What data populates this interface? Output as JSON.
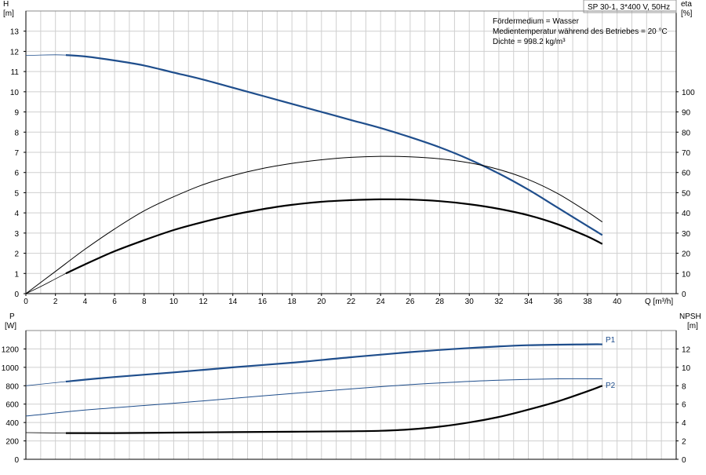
{
  "chart_data": [
    {
      "type": "line",
      "title_box": "SP 30-1, 3*400 V, 50Hz",
      "annotations": [
        "Fördermedium = Wasser",
        "Medientemperatur während des Betriebes = 20 °C",
        "Dichte = 998.2 kg/m³"
      ],
      "ylabel_left": [
        "H",
        "[m]"
      ],
      "ylabel_right": [
        "eta",
        "[%]"
      ],
      "xlabel": "Q [m³/h]",
      "xlim": [
        0,
        44
      ],
      "ylim_left": [
        0,
        14
      ],
      "ylim_right": [
        0,
        140
      ],
      "x_ticks": [
        "0",
        "2",
        "4",
        "6",
        "8",
        "10",
        "12",
        "14",
        "16",
        "18",
        "20",
        "22",
        "24",
        "26",
        "28",
        "30",
        "32",
        "34",
        "36",
        "38",
        "40"
      ],
      "y_left_ticks": [
        "0",
        "1",
        "2",
        "3",
        "4",
        "5",
        "6",
        "7",
        "8",
        "9",
        "10",
        "11",
        "12",
        "13"
      ],
      "y_right_ticks": [
        "0",
        "10",
        "20",
        "30",
        "40",
        "50",
        "60",
        "70",
        "80",
        "90",
        "100"
      ],
      "grid": true,
      "series": [
        {
          "axis": "left",
          "color": "#1f4e8c",
          "style": "thin-start",
          "x": [
            0,
            1,
            2,
            2.7
          ],
          "y": [
            11.8,
            11.82,
            11.83,
            11.82
          ]
        },
        {
          "axis": "left",
          "color": "#1f4e8c",
          "style": "thick",
          "x": [
            2.7,
            4,
            6,
            8,
            10,
            12,
            14,
            16,
            18,
            20,
            22,
            24,
            26,
            28,
            30,
            32,
            34,
            36,
            38,
            39
          ],
          "y": [
            11.82,
            11.75,
            11.55,
            11.3,
            10.95,
            10.6,
            10.2,
            9.8,
            9.4,
            9.0,
            8.6,
            8.2,
            7.75,
            7.25,
            6.65,
            5.95,
            5.15,
            4.25,
            3.35,
            2.9
          ]
        },
        {
          "axis": "right",
          "color": "#000000",
          "style": "thin",
          "x": [
            0,
            2,
            4,
            6,
            8,
            10,
            12,
            14,
            16,
            18,
            20,
            22,
            24,
            26,
            28,
            30,
            32,
            34,
            36,
            38,
            39
          ],
          "y": [
            0,
            11,
            22,
            32,
            41,
            48,
            54,
            58.5,
            62,
            64.5,
            66.3,
            67.5,
            68,
            67.8,
            66.8,
            64.8,
            61.5,
            56.5,
            49.5,
            40.5,
            35.5
          ]
        },
        {
          "axis": "right",
          "color": "#000000",
          "style": "thin-start",
          "x": [
            0,
            1,
            2,
            2.7
          ],
          "y": [
            0,
            3.5,
            7.3,
            10
          ]
        },
        {
          "axis": "right",
          "color": "#000000",
          "style": "thick",
          "x": [
            2.7,
            4,
            6,
            8,
            10,
            12,
            14,
            16,
            18,
            20,
            22,
            24,
            26,
            28,
            30,
            32,
            34,
            36,
            38,
            39
          ],
          "y": [
            10,
            14.5,
            21,
            26.5,
            31.5,
            35.5,
            39,
            41.8,
            44,
            45.5,
            46.3,
            46.7,
            46.6,
            45.8,
            44.3,
            42,
            38.8,
            34.3,
            28.3,
            24.6
          ]
        }
      ]
    },
    {
      "type": "line",
      "ylabel_left": [
        "P",
        "[W]"
      ],
      "ylabel_right": [
        "NPSH",
        "[m]"
      ],
      "xlim": [
        0,
        44
      ],
      "ylim_left": [
        0,
        1400
      ],
      "ylim_right": [
        0,
        14
      ],
      "y_left_ticks": [
        "0",
        "200",
        "400",
        "600",
        "800",
        "1000",
        "1200"
      ],
      "y_right_ticks": [
        "0",
        "2",
        "4",
        "6",
        "8",
        "10",
        "12"
      ],
      "grid": true,
      "series": [
        {
          "name": "P1",
          "axis": "left",
          "color": "#1f4e8c",
          "style": "thin-start",
          "x": [
            0,
            2.7
          ],
          "y": [
            800,
            845
          ]
        },
        {
          "name": "P1",
          "axis": "left",
          "color": "#1f4e8c",
          "style": "thick",
          "x": [
            2.7,
            6,
            10,
            14,
            18,
            22,
            26,
            30,
            34,
            38,
            39
          ],
          "y": [
            845,
            895,
            945,
            1000,
            1050,
            1110,
            1165,
            1210,
            1240,
            1250,
            1250
          ]
        },
        {
          "name": "P2",
          "axis": "left",
          "color": "#1f4e8c",
          "style": "thin",
          "x": [
            0,
            4,
            8,
            12,
            16,
            20,
            24,
            28,
            32,
            36,
            39
          ],
          "y": [
            470,
            535,
            585,
            635,
            690,
            740,
            790,
            830,
            860,
            875,
            875
          ]
        },
        {
          "axis": "right",
          "color": "#000000",
          "style": "thin-start",
          "x": [
            0,
            2.7
          ],
          "y": [
            2.9,
            2.85
          ]
        },
        {
          "axis": "right",
          "color": "#000000",
          "style": "thick",
          "x": [
            2.7,
            6,
            10,
            14,
            18,
            22,
            24,
            26,
            28,
            30,
            32,
            34,
            36,
            38,
            39
          ],
          "y": [
            2.85,
            2.85,
            2.9,
            2.95,
            3.0,
            3.05,
            3.1,
            3.25,
            3.55,
            4.0,
            4.6,
            5.4,
            6.3,
            7.4,
            8.0
          ]
        }
      ]
    }
  ]
}
